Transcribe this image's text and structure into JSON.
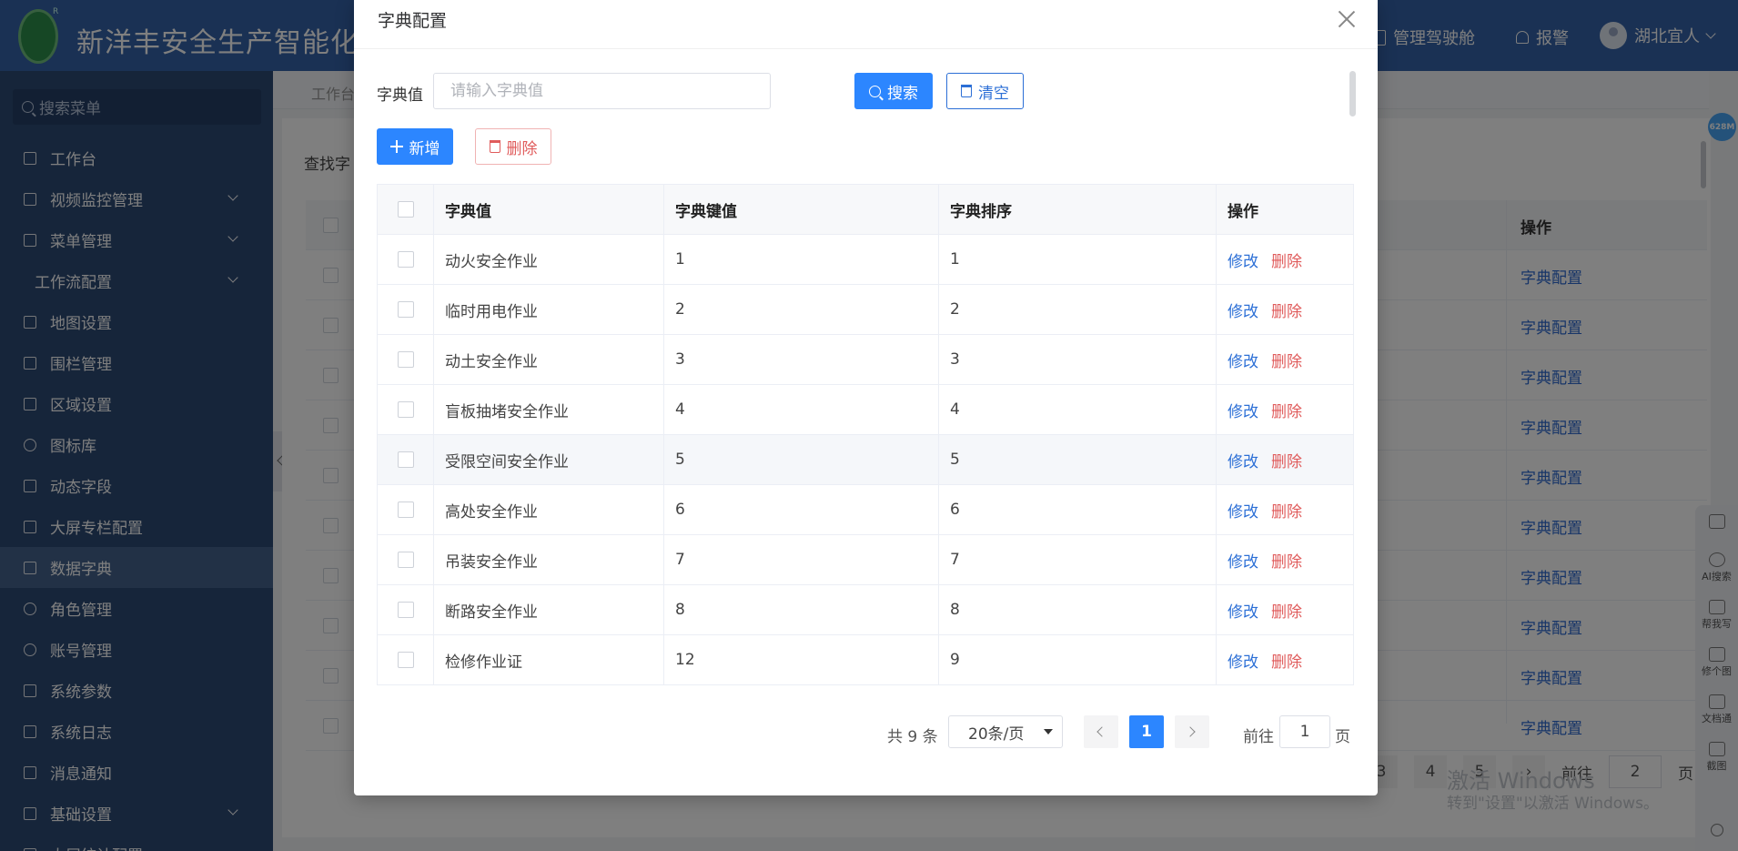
{
  "header": {
    "title": "新洋丰安全生产智能化管",
    "cockpit": "管理驾驶舱",
    "alarm": "报警",
    "user": "湖北宜人",
    "logo_mark": "R"
  },
  "sidebar": {
    "search_placeholder": "搜索菜单",
    "items": [
      {
        "label": "工作台"
      },
      {
        "label": "视频监控管理"
      },
      {
        "label": "菜单管理"
      },
      {
        "label": "工作流配置"
      },
      {
        "label": "地图设置"
      },
      {
        "label": "围栏管理"
      },
      {
        "label": "区域设置"
      },
      {
        "label": "图标库"
      },
      {
        "label": "动态字段"
      },
      {
        "label": "大屏专栏配置"
      },
      {
        "label": "数据字典"
      },
      {
        "label": "角色管理"
      },
      {
        "label": "账号管理"
      },
      {
        "label": "系统参数"
      },
      {
        "label": "系统日志"
      },
      {
        "label": "消息通知"
      },
      {
        "label": "基础设置"
      },
      {
        "label": "大屏统计配置"
      }
    ]
  },
  "background": {
    "tab": "工作台",
    "query_label": "查找字",
    "op_header": "操作",
    "op_link": "字典配置",
    "page_3": "3",
    "page_4": "4",
    "page_5": "5",
    "goto_label": "前往",
    "goto_value": "2",
    "goto_unit": "页",
    "memory_badge": "628M",
    "watermark_title": "激活 Windows",
    "watermark_sub": "转到\"设置\"以激活 Windows。",
    "float_items": [
      "AI搜索",
      "帮我写",
      "修个图",
      "文档通",
      "截图"
    ]
  },
  "dialog": {
    "title": "字典配置",
    "search_label": "字典值",
    "search_placeholder": "请输入字典值",
    "search_button": "搜索",
    "clear_button": "清空",
    "add_button": "新增",
    "delete_button": "删除",
    "columns": [
      "字典值",
      "字典键值",
      "字典排序",
      "操作"
    ],
    "rows": [
      {
        "value": "动火安全作业",
        "key": "1",
        "sort": "1"
      },
      {
        "value": "临时用电作业",
        "key": "2",
        "sort": "2"
      },
      {
        "value": "动土安全作业",
        "key": "3",
        "sort": "3"
      },
      {
        "value": "盲板抽堵安全作业",
        "key": "4",
        "sort": "4"
      },
      {
        "value": "受限空间安全作业",
        "key": "5",
        "sort": "5"
      },
      {
        "value": "高处安全作业",
        "key": "6",
        "sort": "6"
      },
      {
        "value": "吊装安全作业",
        "key": "7",
        "sort": "7"
      },
      {
        "value": "断路安全作业",
        "key": "8",
        "sort": "8"
      },
      {
        "value": "检修作业证",
        "key": "12",
        "sort": "9"
      }
    ],
    "op_edit": "修改",
    "op_delete": "删除",
    "pager": {
      "total": "共 9 条",
      "page_size": "20条/页",
      "current_page": "1",
      "goto_label": "前往",
      "goto_value": "1",
      "goto_unit": "页"
    }
  }
}
